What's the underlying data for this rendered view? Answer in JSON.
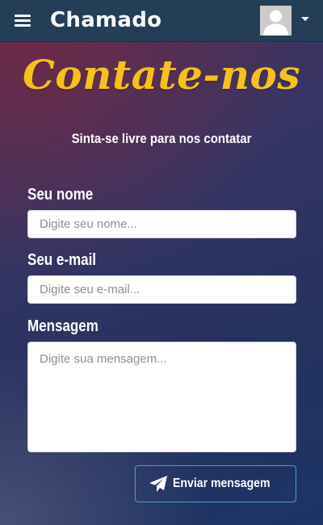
{
  "navbar": {
    "brand": "Chamado",
    "icons": {
      "menu": "hamburger-menu-icon",
      "avatar": "user-avatar",
      "dropdown": "caret-down-icon"
    }
  },
  "contact": {
    "title": "Contate-nos",
    "subtitle": "Sinta-se livre para nos contatar",
    "name_label": "Seu nome",
    "name_placeholder": "Digite seu nome...",
    "email_label": "Seu e-mail",
    "email_placeholder": "Digite seu e-mail...",
    "message_label": "Mensagem",
    "message_placeholder": "Digite sua mensagem...",
    "send_label": "Enviar mensagem",
    "send_icon": "paper-plane-icon"
  },
  "colors": {
    "navbar": "#243e57",
    "title": "#f6c11a",
    "button_border": "#3fa3d1",
    "text": "#ffffff"
  }
}
